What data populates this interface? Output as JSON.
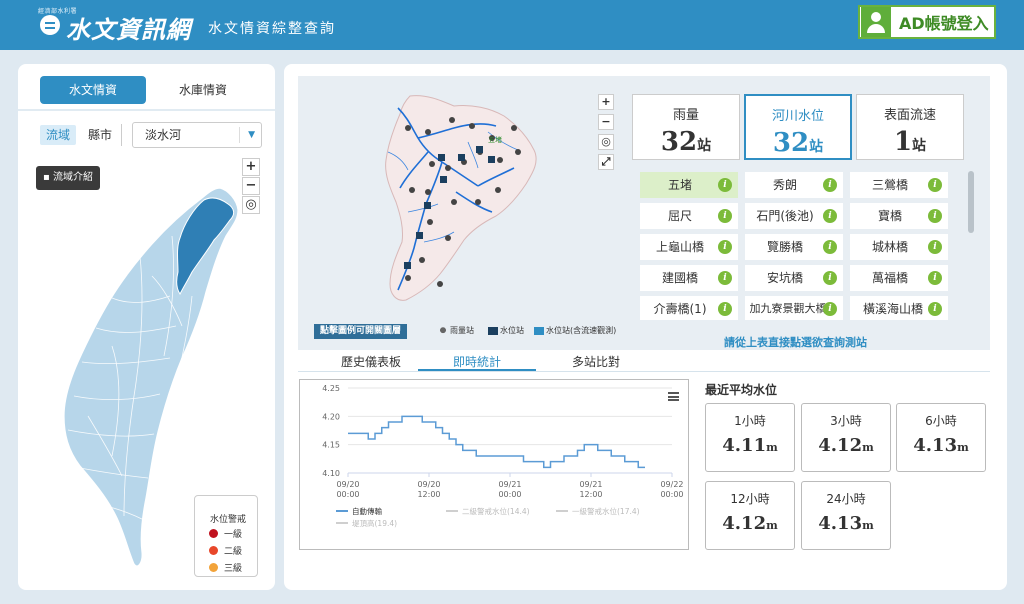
{
  "header": {
    "small_text": "經濟部水利署",
    "title": "水文資訊網",
    "subtitle": "水文情資綜整查詢",
    "login_label": "AD帳號登入"
  },
  "left": {
    "tabs": [
      "水文情資",
      "水庫情資"
    ],
    "filter_basin": "流域",
    "filter_county": "縣市",
    "river_value": "淡水河",
    "basin_intro": "流域介紹",
    "zoom_in": "+",
    "zoom_out": "−",
    "locate": "◎",
    "legend": {
      "title": "水位警戒",
      "items": [
        "一級",
        "二級",
        "三級"
      ],
      "colors": [
        "#c0121f",
        "#e8472a",
        "#f2a33a"
      ]
    }
  },
  "right": {
    "map_ctrls": [
      "+",
      "−",
      "◎",
      "⤢"
    ],
    "map_label": "五堵",
    "legend_hint": "點擊圖例可開關圖層",
    "map_legend": [
      "雨量站",
      "水位站",
      "水位站(含流速觀測)"
    ],
    "station_tabs": [
      {
        "label": "雨量",
        "count": "32",
        "unit": "站"
      },
      {
        "label": "河川水位",
        "count": "32",
        "unit": "站"
      },
      {
        "label": "表面流速",
        "count": "1",
        "unit": "站"
      }
    ],
    "stations": [
      "五堵",
      "秀朗",
      "三鶯橋",
      "屈尺",
      "石門(後池)",
      "寶橋",
      "上龜山橋",
      "覽勝橋",
      "城林橋",
      "建國橋",
      "安坑橋",
      "萬福橋",
      "介壽橋(1)",
      "加九寮景觀大橋",
      "橫溪海山橋"
    ],
    "info_glyph": "i",
    "select_hint": "請從上表直接點選欲查詢測站",
    "view_tabs": [
      "歷史儀表板",
      "即時統計",
      "多站比對"
    ],
    "avg_title": "最近平均水位",
    "avg_cards": [
      {
        "label": "1小時",
        "value": "4.11",
        "unit": "m"
      },
      {
        "label": "3小時",
        "value": "4.12",
        "unit": "m"
      },
      {
        "label": "6小時",
        "value": "4.13",
        "unit": "m"
      },
      {
        "label": "12小時",
        "value": "4.12",
        "unit": "m"
      },
      {
        "label": "24小時",
        "value": "4.13",
        "unit": "m"
      }
    ]
  },
  "chart_data": {
    "type": "line",
    "ylim": [
      4.1,
      4.25
    ],
    "yticks": [
      "4.25",
      "4.20",
      "4.15",
      "4.10"
    ],
    "xticks": [
      {
        "date": "09/20",
        "time": "00:00"
      },
      {
        "date": "09/20",
        "time": "12:00"
      },
      {
        "date": "09/21",
        "time": "00:00"
      },
      {
        "date": "09/21",
        "time": "12:00"
      },
      {
        "date": "09/22",
        "time": "00:00"
      }
    ],
    "series": [
      {
        "name": "自動傳輸",
        "color": "#5b9bd5",
        "x_hours": [
          0,
          2,
          3,
          4,
          5,
          6,
          8,
          9,
          10,
          11,
          12,
          13,
          14,
          15,
          16,
          17,
          18,
          19,
          20,
          21,
          22,
          24,
          26,
          27,
          28,
          29,
          30,
          31,
          32,
          33,
          34,
          35,
          36,
          37,
          38,
          39,
          40,
          41,
          42,
          43,
          44
        ],
        "values": [
          4.17,
          4.17,
          4.16,
          4.17,
          4.18,
          4.19,
          4.2,
          4.2,
          4.2,
          4.19,
          4.19,
          4.18,
          4.17,
          4.16,
          4.15,
          4.14,
          4.14,
          4.13,
          4.13,
          4.13,
          4.13,
          4.13,
          4.12,
          4.12,
          4.12,
          4.11,
          4.12,
          4.12,
          4.13,
          4.13,
          4.14,
          4.15,
          4.15,
          4.14,
          4.14,
          4.13,
          4.13,
          4.12,
          4.12,
          4.11,
          4.11
        ]
      }
    ],
    "legend": [
      "自動傳輸",
      "二級警戒水位(14.4)",
      "一級警戒水位(17.4)",
      "堤頂高(19.4)"
    ]
  }
}
